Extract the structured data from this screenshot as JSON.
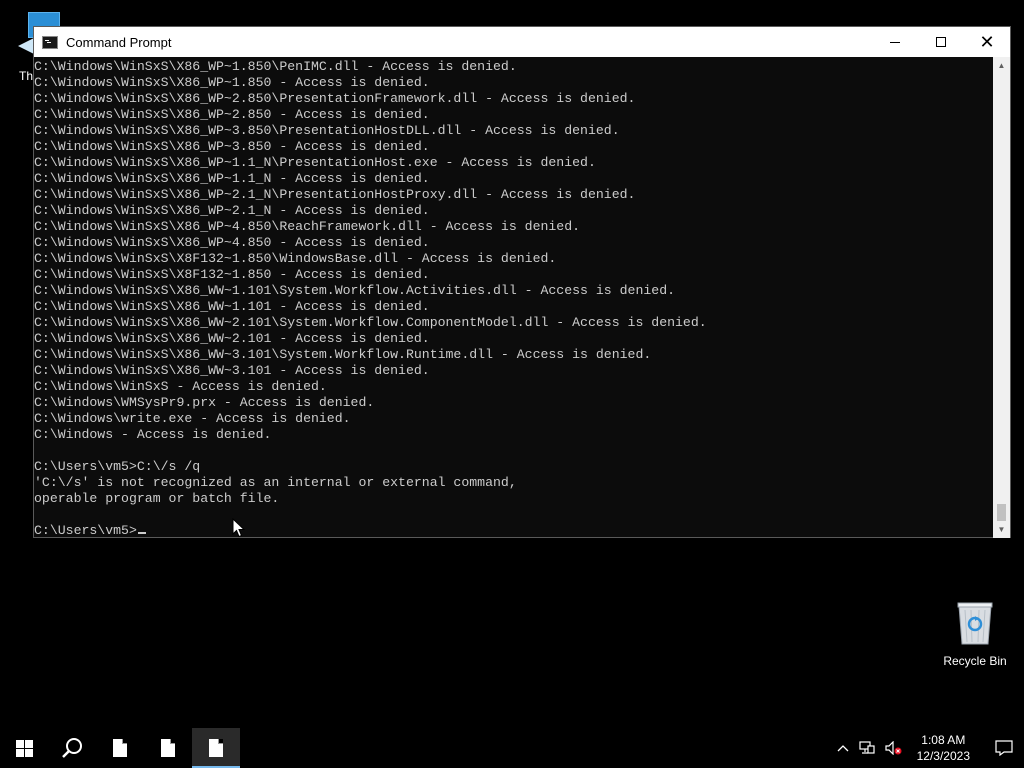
{
  "desktop": {
    "partial_icon_label": "Th",
    "recycle_bin_label": "Recycle Bin"
  },
  "window": {
    "title": "Command Prompt",
    "console_lines": [
      "C:\\Windows\\WinSxS\\X86_WP~1.850\\PenIMC.dll - Access is denied.",
      "C:\\Windows\\WinSxS\\X86_WP~1.850 - Access is denied.",
      "C:\\Windows\\WinSxS\\X86_WP~2.850\\PresentationFramework.dll - Access is denied.",
      "C:\\Windows\\WinSxS\\X86_WP~2.850 - Access is denied.",
      "C:\\Windows\\WinSxS\\X86_WP~3.850\\PresentationHostDLL.dll - Access is denied.",
      "C:\\Windows\\WinSxS\\X86_WP~3.850 - Access is denied.",
      "C:\\Windows\\WinSxS\\X86_WP~1.1_N\\PresentationHost.exe - Access is denied.",
      "C:\\Windows\\WinSxS\\X86_WP~1.1_N - Access is denied.",
      "C:\\Windows\\WinSxS\\X86_WP~2.1_N\\PresentationHostProxy.dll - Access is denied.",
      "C:\\Windows\\WinSxS\\X86_WP~2.1_N - Access is denied.",
      "C:\\Windows\\WinSxS\\X86_WP~4.850\\ReachFramework.dll - Access is denied.",
      "C:\\Windows\\WinSxS\\X86_WP~4.850 - Access is denied.",
      "C:\\Windows\\WinSxS\\X8F132~1.850\\WindowsBase.dll - Access is denied.",
      "C:\\Windows\\WinSxS\\X8F132~1.850 - Access is denied.",
      "C:\\Windows\\WinSxS\\X86_WW~1.101\\System.Workflow.Activities.dll - Access is denied.",
      "C:\\Windows\\WinSxS\\X86_WW~1.101 - Access is denied.",
      "C:\\Windows\\WinSxS\\X86_WW~2.101\\System.Workflow.ComponentModel.dll - Access is denied.",
      "C:\\Windows\\WinSxS\\X86_WW~2.101 - Access is denied.",
      "C:\\Windows\\WinSxS\\X86_WW~3.101\\System.Workflow.Runtime.dll - Access is denied.",
      "C:\\Windows\\WinSxS\\X86_WW~3.101 - Access is denied.",
      "C:\\Windows\\WinSxS - Access is denied.",
      "C:\\Windows\\WMSysPr9.prx - Access is denied.",
      "C:\\Windows\\write.exe - Access is denied.",
      "C:\\Windows - Access is denied.",
      "",
      "C:\\Users\\vm5>C:\\/s /q",
      "'C:\\/s' is not recognized as an internal or external command,",
      "operable program or batch file.",
      ""
    ],
    "prompt": "C:\\Users\\vm5>"
  },
  "taskbar": {
    "time": "1:08 AM",
    "date": "12/3/2023",
    "buttons": [
      "start-button",
      "search-button",
      "taskbar-app-1",
      "taskbar-app-2",
      "taskbar-app-3"
    ]
  },
  "colors": {
    "console_bg": "#0c0c0c",
    "console_text": "#cccccc",
    "taskbar_accent": "#76b9ed"
  }
}
